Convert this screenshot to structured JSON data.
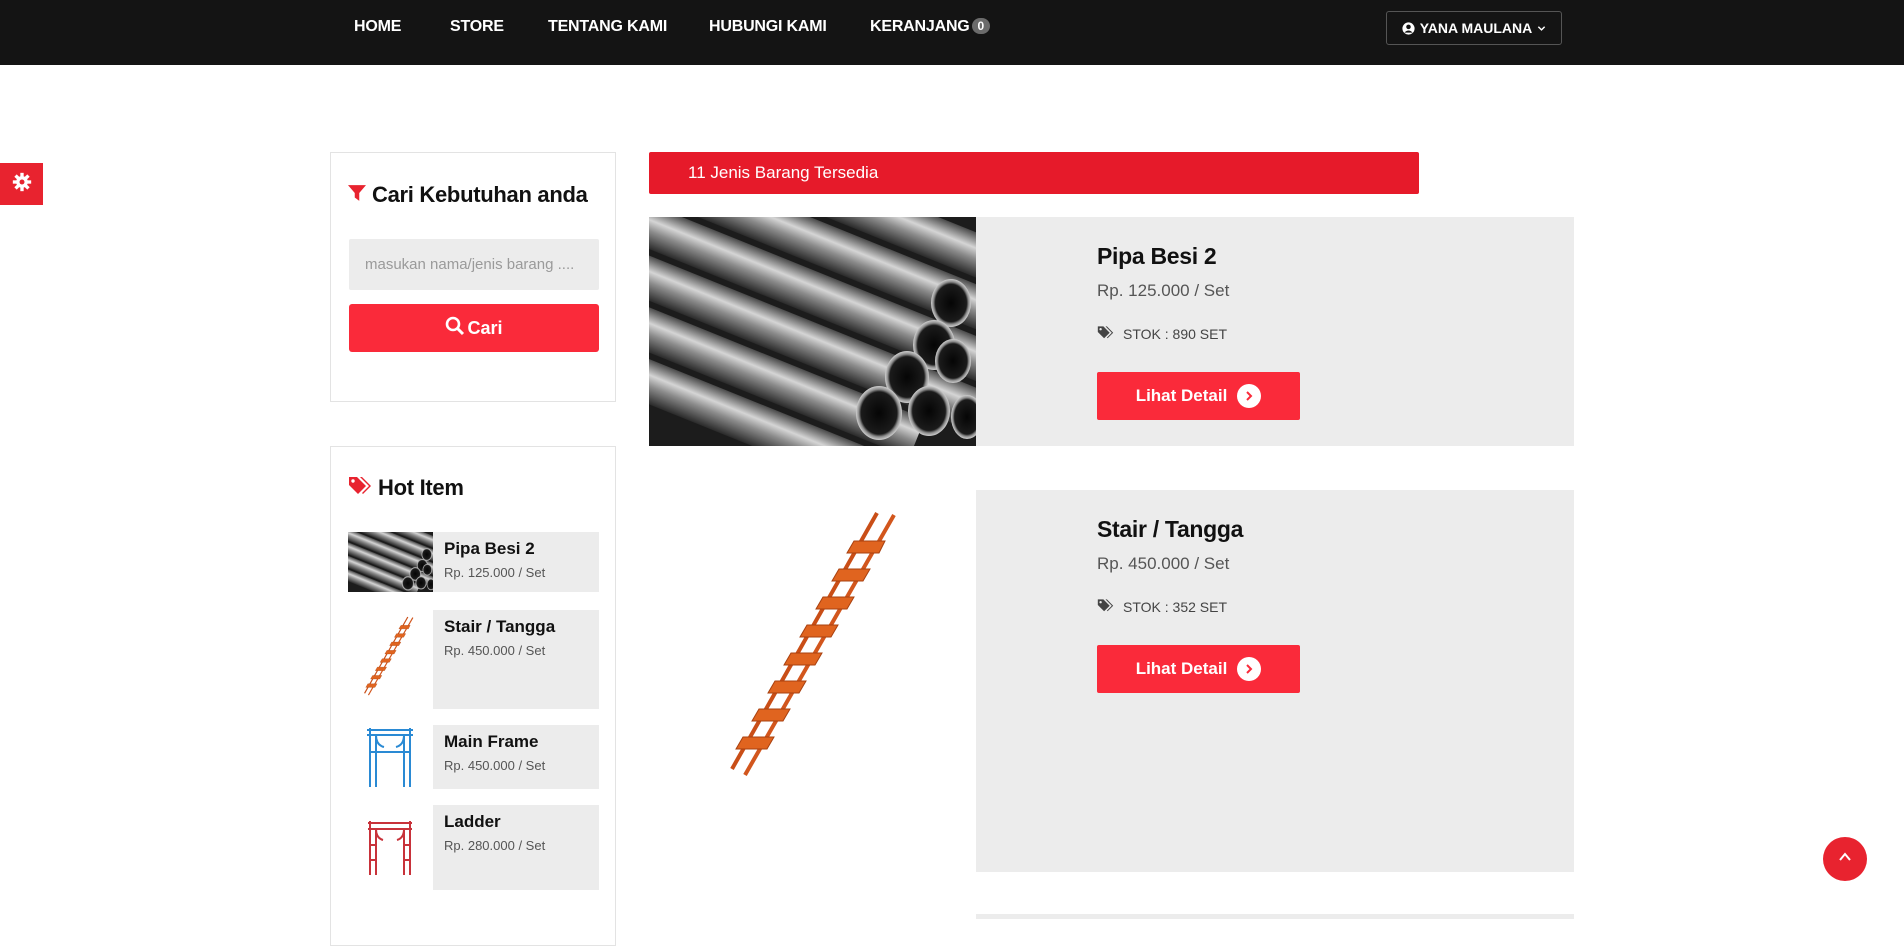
{
  "nav": {
    "items": [
      "HOME",
      "STORE",
      "TENTANG KAMI",
      "HUBUNGI KAMI",
      "KERANJANG"
    ],
    "cart_count": "0",
    "user_name": "YANA MAULANA"
  },
  "search": {
    "title": "Cari Kebutuhan anda",
    "placeholder": "masukan nama/jenis barang ....",
    "button_label": "Cari"
  },
  "hot": {
    "title": "Hot Item",
    "items": [
      {
        "name": "Pipa Besi 2",
        "price": "Rp. 125.000 / Set",
        "icon": "steel-pipes"
      },
      {
        "name": "Stair / Tangga",
        "price": "Rp. 450.000 / Set",
        "icon": "orange-stair"
      },
      {
        "name": "Main Frame",
        "price": "Rp. 450.000 / Set",
        "icon": "blue-frame"
      },
      {
        "name": "Ladder",
        "price": "Rp. 280.000 / Set",
        "icon": "red-ladder-frame"
      }
    ]
  },
  "banner": "11 Jenis Barang Tersedia",
  "products": [
    {
      "name": "Pipa Besi 2",
      "price": "Rp. 125.000 / Set",
      "stock": "STOK : 890 SET",
      "button": "Lihat Detail",
      "icon": "steel-pipes"
    },
    {
      "name": "Stair / Tangga",
      "price": "Rp. 450.000 / Set",
      "stock": "STOK : 352 SET",
      "button": "Lihat Detail",
      "icon": "orange-stair"
    }
  ],
  "colors": {
    "accent": "#fa2a3a",
    "banner": "#e61a2a",
    "navbar": "#141414",
    "panel": "#ececec"
  }
}
